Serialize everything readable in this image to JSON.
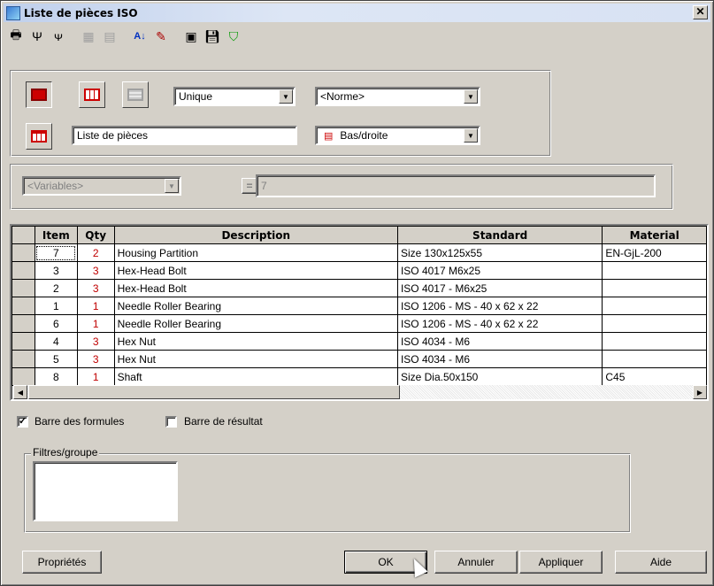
{
  "window": {
    "title": "Liste de pièces ISO"
  },
  "toolbar": {
    "icons": [
      "printer-icon",
      "sort-filter-icon",
      "group-icon",
      "columns-icon",
      "merge-icon",
      "sort-az-icon",
      "edit-icon",
      "export-icon",
      "save-icon",
      "shield-icon"
    ]
  },
  "settings": {
    "mode_select": "Unique",
    "norm_select": "<Norme>",
    "title_input": "Liste de pièces",
    "position_select": "Bas/droite"
  },
  "formula": {
    "variables_select": "<Variables>",
    "equals": "=",
    "value": "7"
  },
  "table": {
    "columns": [
      "Item",
      "Qty",
      "Description",
      "Standard",
      "Material"
    ],
    "rows": [
      {
        "item": "7",
        "qty": "2",
        "description": "Housing Partition",
        "standard": "Size 130x125x55",
        "material": "EN-GjL-200"
      },
      {
        "item": "3",
        "qty": "3",
        "description": "Hex-Head Bolt",
        "standard": "ISO 4017 M6x25",
        "material": ""
      },
      {
        "item": "2",
        "qty": "3",
        "description": "Hex-Head Bolt",
        "standard": "ISO 4017 - M6x25",
        "material": ""
      },
      {
        "item": "1",
        "qty": "1",
        "description": "Needle Roller Bearing",
        "standard": "ISO 1206 - MS  - 40 x 62 x 22",
        "material": ""
      },
      {
        "item": "6",
        "qty": "1",
        "description": "Needle Roller Bearing",
        "standard": "ISO 1206 - MS  - 40 x 62 x 22",
        "material": ""
      },
      {
        "item": "4",
        "qty": "3",
        "description": "Hex Nut",
        "standard": "ISO 4034 - M6",
        "material": ""
      },
      {
        "item": "5",
        "qty": "3",
        "description": "Hex Nut",
        "standard": "ISO 4034 - M6",
        "material": ""
      },
      {
        "item": "8",
        "qty": "1",
        "description": "Shaft",
        "standard": "Size Dia.50x150",
        "material": "C45"
      }
    ]
  },
  "options": {
    "formula_bar_label": "Barre des formules",
    "formula_bar_checked": true,
    "result_bar_label": "Barre de résultat",
    "result_bar_checked": false
  },
  "filters": {
    "legend": "Filtres/groupe"
  },
  "buttons": {
    "properties": "Propriétés",
    "ok": "OK",
    "cancel": "Annuler",
    "apply": "Appliquer",
    "help": "Aide"
  }
}
